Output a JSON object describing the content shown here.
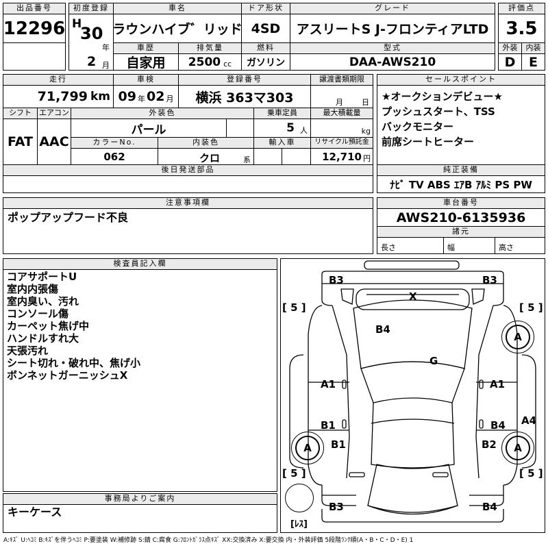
{
  "header": {
    "lot_no_label": "出品番号",
    "lot_no": "12296",
    "first_reg_label": "初度登録",
    "era": "H",
    "year": "30",
    "year_unit": "年",
    "month": "2",
    "month_unit": "月",
    "car_name_label": "車名",
    "car_name": "クラウンハイブ゛リッド゛",
    "door_label": "ドア形状",
    "door": "4SD",
    "grade_label": "グレード",
    "grade": "アスリートS J-フロンティアLTD",
    "score_label": "評価点",
    "score": "3.5",
    "history_label": "車歴",
    "history": "自家用",
    "displacement_label": "排気量",
    "displacement": "2500",
    "displacement_unit": "cc",
    "fuel_label": "燃料",
    "fuel": "ガソリン",
    "model_label": "型式",
    "model": "DAA-AWS210",
    "ext_label": "外装",
    "int_label": "内装",
    "ext_grade": "D",
    "int_grade": "E"
  },
  "specs": {
    "mileage_label": "走行",
    "mileage": "71,799",
    "mileage_unit": "km",
    "inspection_label": "車検",
    "insp_year": "09",
    "insp_year_unit": "年",
    "insp_month": "02",
    "insp_month_unit": "月",
    "reg_no_label": "登録番号",
    "reg_no": "横浜 363マ303",
    "transfer_label": "譲渡書類期限",
    "transfer_month_unit": "月",
    "transfer_day_unit": "日",
    "shift_label": "シフト",
    "shift": "FAT",
    "ac_label": "エアコン",
    "ac": "AAC",
    "ext_color_label": "外装色",
    "ext_color": "パール",
    "capacity_label": "乗車定員",
    "capacity": "5",
    "capacity_unit": "人",
    "load_label": "最大積載量",
    "load_unit": "kg",
    "color_no_label": "カラーNo.",
    "color_no": "062",
    "int_color_label": "内装色",
    "int_color": "クロ",
    "int_color_unit": "系",
    "import_label": "輸入車",
    "recycle_label": "リサイクル預託金",
    "recycle": "12,710",
    "recycle_unit": "円",
    "later_parts_label": "後日発送部品"
  },
  "sales_points": {
    "label": "セールスポイント",
    "items": [
      "★オークションデビュー★",
      "プッシュスタート、TSS",
      "バックモニター",
      "前席シートヒーター"
    ]
  },
  "equipment": {
    "label": "純正装備",
    "items": "ﾅﾋﾞ TV ABS ｴｱB ｱﾙﾐ PS PW"
  },
  "notes": {
    "label": "注意事項欄",
    "text": "ポップアップフード不良"
  },
  "chassis": {
    "label": "車台番号",
    "number": "AWS210-6135936",
    "dims_label": "諸元",
    "length_label": "長さ",
    "width_label": "幅",
    "height_label": "高さ"
  },
  "inspector": {
    "label": "検査員記入欄",
    "items": [
      "コアサポートU",
      "室内内張傷",
      "室内臭い、汚れ",
      "コンソール傷",
      "カーペット焦げ中",
      "ハンドルすれ大",
      "天張汚れ",
      "シート切れ・破れ中、焦げ小",
      "ボンネットガーニッシュX"
    ]
  },
  "office": {
    "label": "事務局よりご案内",
    "text": "キーケース"
  },
  "diagram": {
    "marks": {
      "b3_tl": "B3",
      "b3_tr": "B3",
      "x": "X",
      "b4_hood": "B4",
      "g": "G",
      "a1_l": "A1",
      "a1_r": "A1",
      "b1_l": "B1",
      "b4_r": "B4",
      "a4": "A4",
      "b1_wheel": "B1",
      "b2": "B2",
      "b3_bl": "B3",
      "b4_br": "B4",
      "a_fl": "A",
      "a_fr": "A",
      "a_rl": "A",
      "a_rr": "A",
      "tire_tl": "[ 5 ]",
      "tire_tr": "[ 5 ]",
      "tire_bl": "[ 5 ]",
      "tire_br": "[ 5 ]",
      "spare": "[ﾚｽ]"
    }
  },
  "legend": "A:ｷｽﾞ U:ﾍｺﾐ B:ｷｽﾞを伴うﾍｺﾐ P:要塗装 W:補修跡 S:錆 C:腐食 G:ﾌﾛﾝﾄｶﾞﾗｽ点ｷｽﾞ XX:交換済み X:要交換 内・外装評価 5段階ﾗﾝｸ順(A・B・C・D・E) 1"
}
